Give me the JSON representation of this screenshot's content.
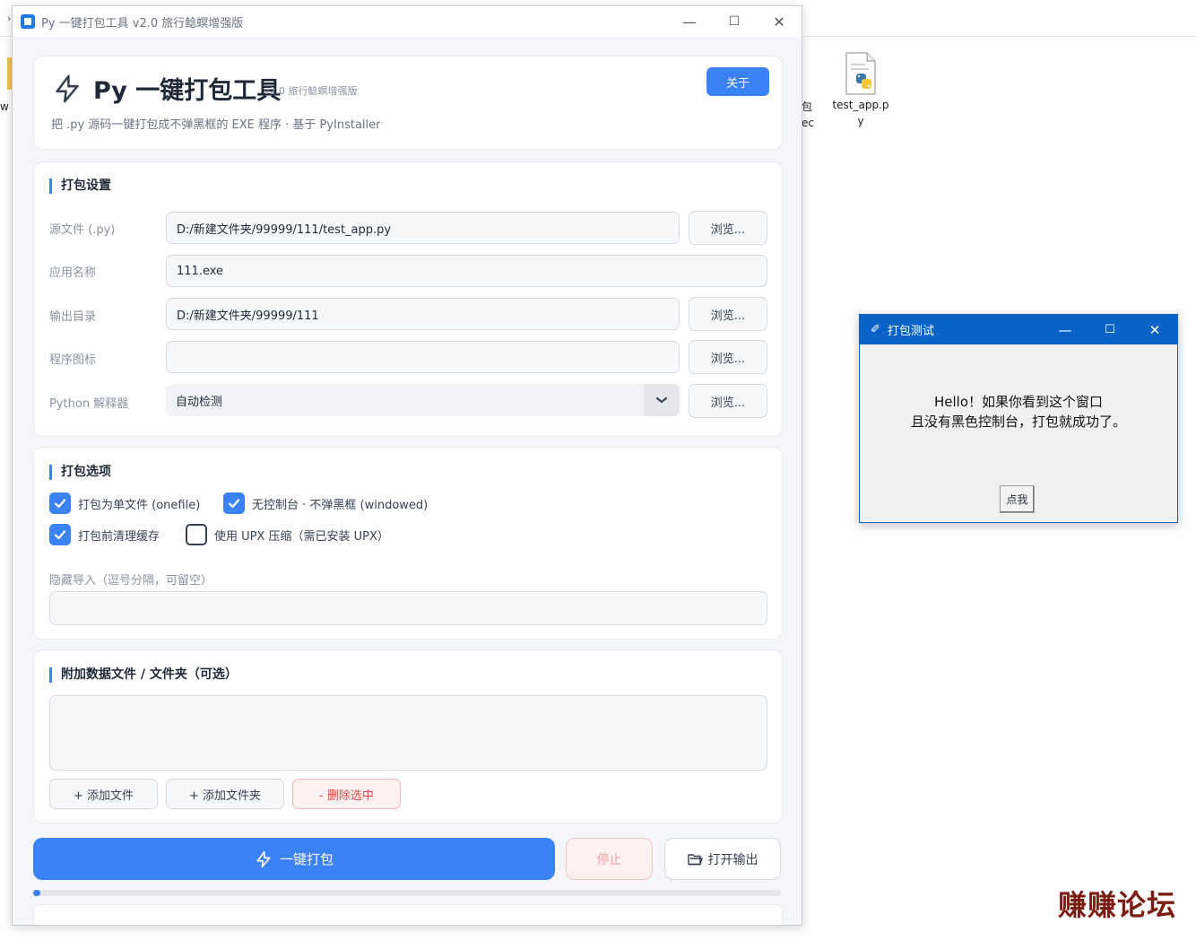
{
  "window": {
    "title": "Py 一键打包工具  v2.0 旅行鲶螟增强版",
    "minimize": "—",
    "maximize": "☐",
    "close": "✕"
  },
  "header": {
    "app_name": "Py 一键打包工具",
    "version": "v2.0 旅行鲶螟增强版",
    "subtitle": "把 .py 源码一键打包成不弹黑框的 EXE 程序 · 基于 PyInstaller",
    "about_label": "关于"
  },
  "settings": {
    "title": "打包设置",
    "source_label": "源文件 (.py)",
    "source_value": "D:/新建文件夹/99999/111/test_app.py",
    "name_label": "应用名称",
    "name_value": "111.exe",
    "output_label": "输出目录",
    "output_value": "D:/新建文件夹/99999/111",
    "icon_label": "程序图标",
    "icon_value": "",
    "python_label": "Python 解释器",
    "python_value": "自动检测",
    "browse_label": "浏览..."
  },
  "options": {
    "title": "打包选项",
    "onefile": {
      "label": "打包为单文件 (onefile)",
      "checked": true
    },
    "windowed": {
      "label": "无控制台 · 不弹黑框 (windowed)",
      "checked": true
    },
    "clean": {
      "label": "打包前清理缓存",
      "checked": true
    },
    "upx": {
      "label": "使用 UPX 压缩（需已安装 UPX）",
      "checked": false
    },
    "hidden_label": "隐藏导入（逗号分隔，可留空）",
    "hidden_value": ""
  },
  "data_files": {
    "title": "附加数据文件 / 文件夹（可选）",
    "add_file": "+ 添加文件",
    "add_folder": "+ 添加文件夹",
    "remove": "- 删除选中"
  },
  "actions": {
    "build": "一键打包",
    "stop": "停止",
    "open_output": "打开输出",
    "progress": 0.01
  },
  "desktop": {
    "icon_label_line1": "test_app.p",
    "icon_label_line2": "y",
    "partial_left": "w",
    "partial_right_1": "包",
    "partial_right_2": "ec",
    "watermark": "赚赚论坛"
  },
  "test_window": {
    "title": "打包测试",
    "message_line1": "Hello！如果你看到这个窗口",
    "message_line2": "且没有黑色控制台，打包就成功了。",
    "button": "点我"
  },
  "colors": {
    "accent": "#3b82f6",
    "danger": "#e24b4b",
    "titlebar_blue": "#0a64c8"
  }
}
